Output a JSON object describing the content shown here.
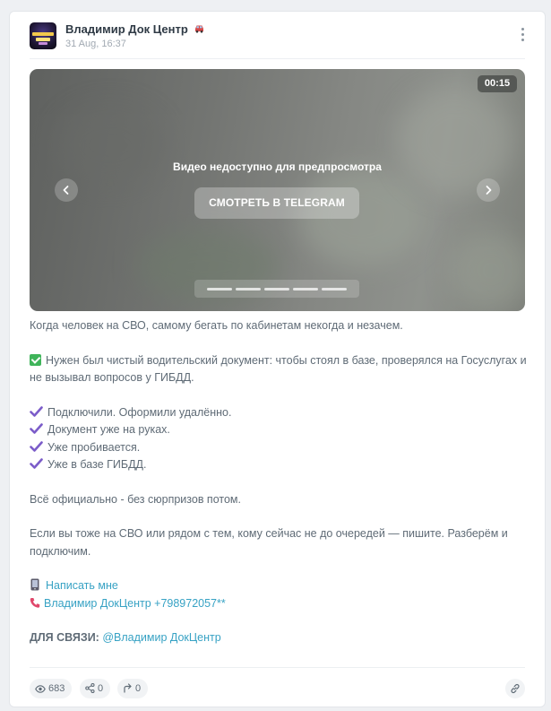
{
  "post": {
    "channel_name": "Владимир Док Центр",
    "channel_icon": "car-icon",
    "time": "31 Aug, 16:37"
  },
  "video": {
    "duration": "00:15",
    "unavailable_text": "Видео недоступно для предпросмотра",
    "button_label": "СМОТРЕТЬ В TELEGRAM",
    "slide_count": 5
  },
  "text": {
    "intro": "Когда человек на СВО, самому бегать по кабинетам некогда и незачем.",
    "need": "Нужен был чистый водительский документ: чтобы стоял в базе, проверялся на Госуслугах и не вызывал вопросов у ГИБДД.",
    "steps": [
      "Подключили. Оформили удалённо.",
      "Документ уже на руках.",
      "Уже пробивается.",
      "Уже в базе ГИБДД."
    ],
    "official": "Всё официально - без сюрпризов потом.",
    "cta": "Если вы тоже на СВО или рядом с тем, кому сейчас не до очередей — пишите. Разберём и подключим.",
    "write_link": "Написать мне",
    "phone_link": "Владимир ДокЦентр +798972057**",
    "contact_label": "ДЛЯ СВЯЗИ:",
    "contact_link": "@Владимир ДокЦентр"
  },
  "stats": {
    "views": "683",
    "shares": "0",
    "forwards": "0"
  },
  "colors": {
    "link": "#37a2c4",
    "check": "#3fb45a",
    "tick": "#7b5cc9"
  }
}
